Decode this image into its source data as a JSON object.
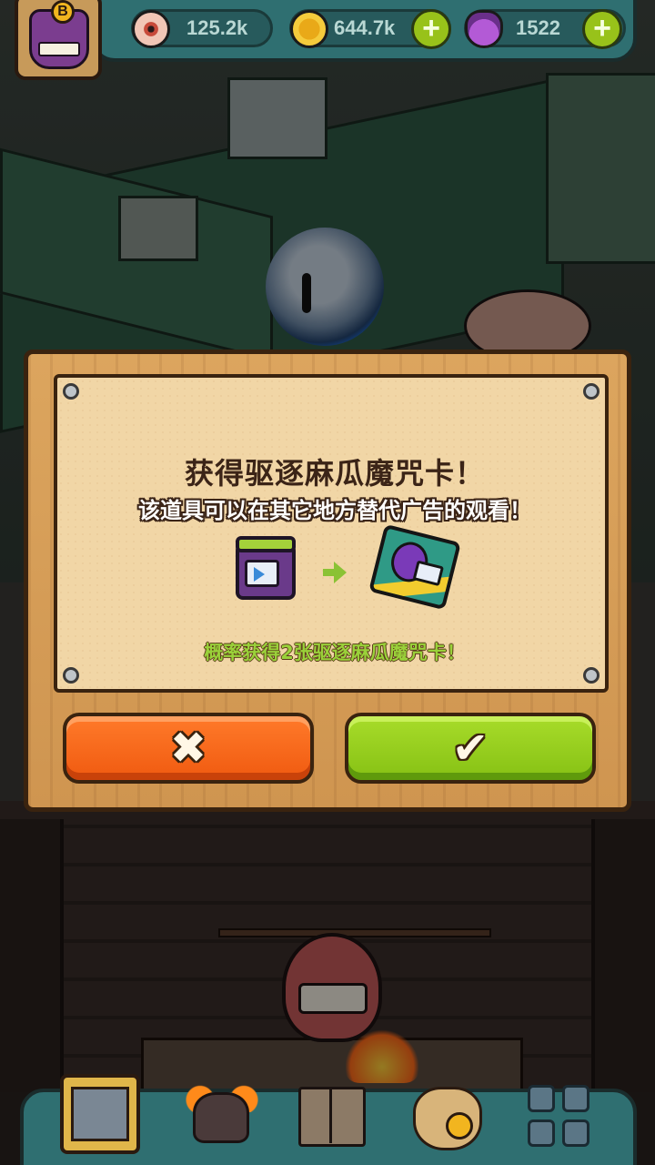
{
  "top_bar": {
    "avatar_badge": "B",
    "resources": [
      {
        "icon": "eyeball-icon",
        "value": "125.2k"
      },
      {
        "icon": "coin-icon",
        "value": "644.7k"
      },
      {
        "icon": "potion-icon",
        "value": "1522"
      }
    ],
    "plus_label": "+"
  },
  "dialog": {
    "title": "获得驱逐麻瓜魔咒卡！",
    "subtitle": "该道具可以在其它地方替代广告的观看！",
    "note": "概率获得2张驱逐麻瓜魔咒卡！",
    "cancel_glyph": "✖",
    "confirm_glyph": "✔"
  },
  "colors": {
    "dialog_frame": "#d99f58",
    "parchment": "#f1d6a6",
    "cancel_button": "#f05a10",
    "confirm_button": "#86c114",
    "note_text": "#9ad13a",
    "hud_teal": "#2f6f71"
  },
  "bottom_nav": [
    {
      "icon": "shop-building-icon"
    },
    {
      "icon": "monster-icon"
    },
    {
      "icon": "book-icon"
    },
    {
      "icon": "money-bag-icon"
    },
    {
      "icon": "grid-menu-icon"
    }
  ]
}
